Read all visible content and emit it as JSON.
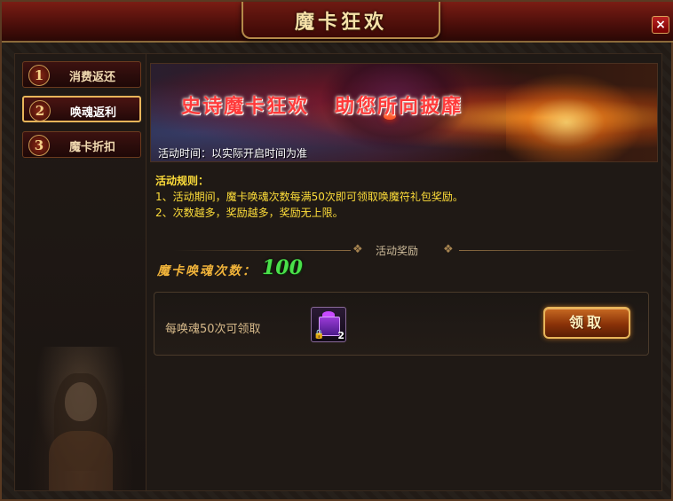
{
  "window": {
    "title": "魔卡狂欢",
    "close_label": "×"
  },
  "sidebar": {
    "items": [
      {
        "num": "1",
        "label": "消费返还",
        "active": false
      },
      {
        "num": "2",
        "label": "唤魂返利",
        "active": true
      },
      {
        "num": "3",
        "label": "魔卡折扣",
        "active": false
      }
    ]
  },
  "banner": {
    "slogan": "史诗魔卡狂欢   助您所向披靡",
    "time": "活动时间：以实际开启时间为准"
  },
  "rules": {
    "title": "活动规则：",
    "lines": [
      "1、活动期间，魔卡唤魂次数每满50次即可领取唤魔符礼包奖励。",
      "2、次数越多，奖励越多，奖励无上限。"
    ]
  },
  "rewards": {
    "section_label": "活动奖励",
    "count_label": "魔卡唤魂次数：",
    "count_value": "100",
    "row_text": "每唤魂50次可领取",
    "item_quantity": "2",
    "claim_label": "领取"
  },
  "colors": {
    "header_red": "#7a1d14",
    "gold_border": "#e8b55a",
    "rule_text": "#ffde3a",
    "count_green": "#4ae04a",
    "slogan_red": "#ff3a3a"
  },
  "icons": {
    "close": "close-icon",
    "gift": "gift-box-icon",
    "lock": "lock-icon"
  }
}
